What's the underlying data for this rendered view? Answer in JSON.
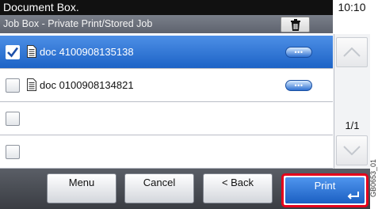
{
  "header": {
    "title": "Document Box.",
    "clock": "10:10"
  },
  "subheader": {
    "title": "Job Box - Private Print/Stored Job",
    "trash_icon": "trash-icon"
  },
  "list": {
    "rows": [
      {
        "name": "doc 4100908135138",
        "checked": true
      },
      {
        "name": "doc 0100908134821",
        "checked": false
      },
      {
        "name": "",
        "checked": false
      },
      {
        "name": "",
        "checked": false
      }
    ],
    "more_label": "•••"
  },
  "scroll": {
    "page_indicator": "1/1"
  },
  "footer": {
    "menu_label": "Menu",
    "cancel_label": "Cancel",
    "back_label": "< Back",
    "print_label": "Print"
  },
  "figure_code": "GB0653_01",
  "colors": {
    "selected": "#2a6fd6",
    "highlight": "#e4001b"
  }
}
